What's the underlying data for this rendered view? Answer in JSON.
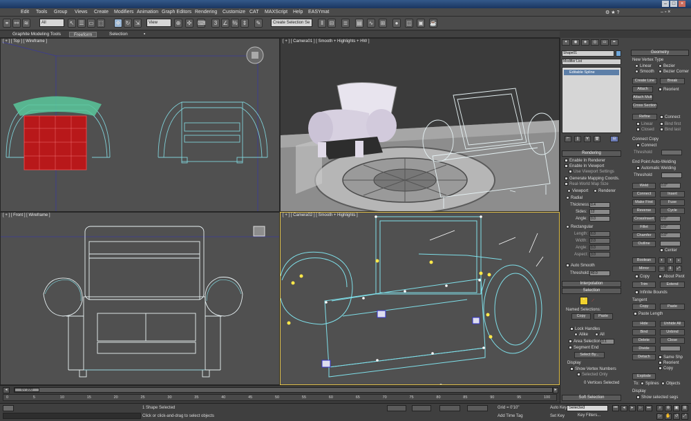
{
  "menu": [
    "Edit",
    "Tools",
    "Group",
    "Views",
    "Create",
    "Modifiers",
    "Animation",
    "Graph Editors",
    "Rendering",
    "Customize",
    "CAT",
    "MAXScript",
    "Help",
    "EASYmat"
  ],
  "toolbar": {
    "filter_value": "All",
    "ref_coord_value": "View",
    "selection_set_placeholder": "Create Selection Se"
  },
  "ribbon": {
    "tabs": [
      "Graphite Modeling Tools",
      "Freeform",
      "Selection"
    ]
  },
  "viewports": {
    "top": "[ + ] [ Top ] [ Wireframe ]",
    "camera01": "[ + ] [ Camera01 ] [ Smooth + Highlights + HW ]",
    "front": "[ + ] [ Front ] [ Wireframe ]",
    "camera02": "[ + ] [ Camera02 ] [ Smooth + Highlights ]"
  },
  "command_panel": {
    "object_name": "Shape01",
    "modifier_list": "Modifier List",
    "stack_item": "Editable Spline",
    "rendering": {
      "title": "Rendering",
      "enable_renderer": "Enable In Renderer",
      "enable_viewport": "Enable In Viewport",
      "use_viewport_settings": "Use Viewport Settings",
      "gen_mapping": "Generate Mapping Coords.",
      "real_world": "Real-World Map Size",
      "viewport": "Viewport",
      "renderer": "Renderer",
      "radial": "Radial",
      "thickness_label": "Thickness:",
      "thickness_value": "0.4",
      "sides_label": "Sides:",
      "sides_value": "12",
      "angle_label": "Angle:",
      "angle_value": "0.0",
      "rectangular": "Rectangular",
      "length_label": "Length:",
      "length_value": "6.0",
      "width_label": "Width:",
      "width_value": "2.0",
      "angle2_label": "Angle:",
      "angle2_value": "0.0",
      "aspect_label": "Aspect:",
      "aspect_value": "3.0",
      "auto_smooth": "Auto Smooth",
      "threshold_label": "Threshold:",
      "threshold_value": "40.0"
    },
    "interpolation": "Interpolation",
    "selection": {
      "title": "Selection",
      "named_selections": "Named Selections:",
      "copy": "Copy",
      "paste": "Paste",
      "lock_handles": "Lock Handles",
      "alike": "Alike",
      "all": "All",
      "area_selection": "Area Selection:",
      "area_value": "0.1",
      "segment_end": "Segment End",
      "select_by": "Select By...",
      "display": "Display",
      "show_vertex_numbers": "Show Vertex Numbers",
      "selected_only": "Selected Only",
      "vertices_selected": "0 Vertices Selected"
    },
    "soft_selection": "Soft Selection",
    "geometry": {
      "title": "Geometry",
      "new_vertex_type": "New Vertex Type",
      "linear": "Linear",
      "bezier": "Bezier",
      "smooth": "Smooth",
      "bezier_corner": "Bezier Corner",
      "create_line": "Create Line",
      "break": "Break",
      "attach": "Attach",
      "reorient": "Reorient",
      "attach_mult": "Attach Mult.",
      "cross_section": "Cross Section",
      "refine": "Refine",
      "connect": "Connect",
      "linear2": "Linear",
      "bind_first": "Bind first",
      "closed": "Closed",
      "bind_last": "Bind last",
      "connect_copy": "Connect Copy",
      "connect2": "Connect",
      "threshold": "Threshold",
      "end_point_auto_welding": "End Point Auto-Welding",
      "automatic_welding": "Automatic Welding",
      "threshold2": "Threshold",
      "weld": "Weld",
      "weld_value": "0.0\"",
      "connect3": "Connect",
      "insert": "Insert",
      "make_first": "Make First",
      "fuse": "Fuse",
      "reverse": "Reverse",
      "cycle": "Cycle",
      "crossinsert": "CrossInsert",
      "crossinsert_value": "0.0\"",
      "fillet": "Fillet",
      "fillet_value": "0.0\"",
      "chamfer": "Chamfer",
      "chamfer_value": "0.0\"",
      "outline": "Outline",
      "center": "Center",
      "boolean": "Boolean",
      "mirror": "Mirror",
      "copy": "Copy",
      "about_pivot": "About Pivot",
      "trim": "Trim",
      "extend": "Extend",
      "infinite_bounds": "Infinite Bounds",
      "tangent": "Tangent",
      "copy2": "Copy",
      "paste2": "Paste",
      "paste_length": "Paste Length",
      "hide": "Hide",
      "unhide_all": "Unhide All",
      "bind": "Bind",
      "unbind": "Unbind",
      "delete": "Delete",
      "close": "Close",
      "divide": "Divide",
      "detach": "Detach",
      "same_shp": "Same Shp",
      "reorient2": "Reorient",
      "copy3": "Copy",
      "explode": "Explode",
      "to": "To:",
      "splines": "Splines",
      "objects": "Objects",
      "display": "Display",
      "show_selected_segs": "Show selected segs"
    }
  },
  "timeline": {
    "frame": "0 / 100",
    "ticks": [
      "0",
      "5",
      "10",
      "15",
      "20",
      "25",
      "30",
      "35",
      "40",
      "45",
      "50",
      "55",
      "60",
      "65",
      "70",
      "75",
      "80",
      "85",
      "90",
      "95",
      "100"
    ]
  },
  "status": {
    "selected_text": "1 Shape Selected",
    "prompt": "Click or click-and-drag to select objects",
    "grid": "Grid = 0'10\"",
    "add_time_tag": "Add Time Tag",
    "auto_key": "Auto Key",
    "set_key": "Set Key",
    "key_mode_value": "Selected",
    "key_filters": "Key Filters..."
  }
}
